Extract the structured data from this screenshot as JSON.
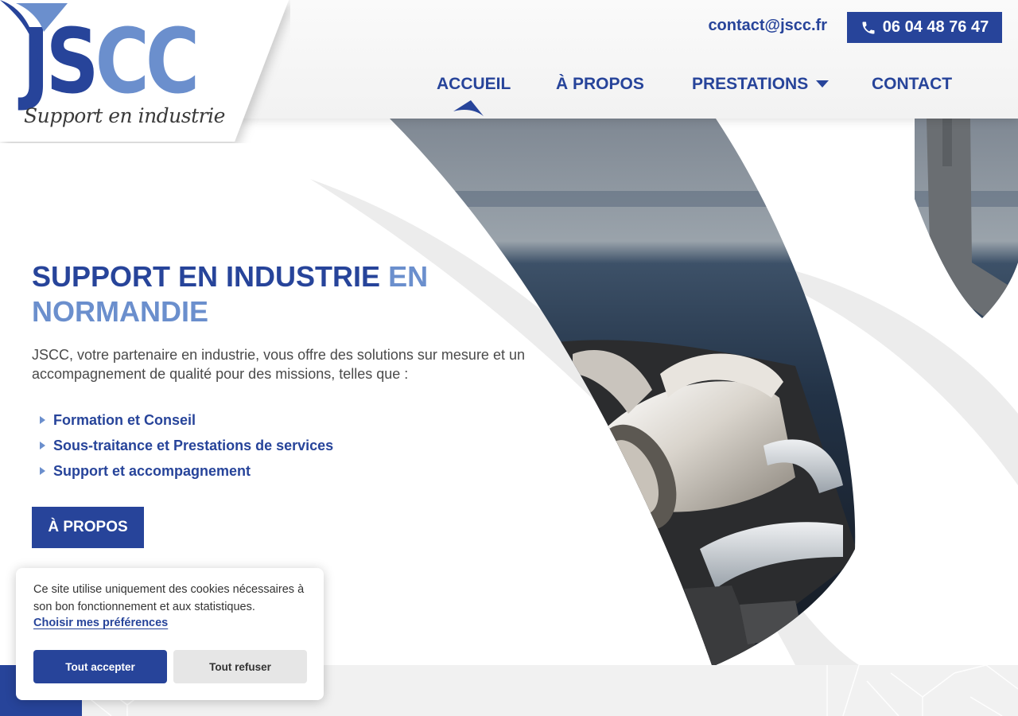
{
  "brand": {
    "logo_part1": "JS",
    "logo_part2": "CC",
    "tagline": "Support en industrie"
  },
  "header": {
    "email": "contact@jscc.fr",
    "phone": "06 04 48 76 47"
  },
  "nav": {
    "items": [
      {
        "label": "ACCUEIL",
        "active": true
      },
      {
        "label": "À PROPOS",
        "active": false
      },
      {
        "label": "PRESTATIONS",
        "active": false,
        "has_dropdown": true
      },
      {
        "label": "CONTACT",
        "active": false
      }
    ]
  },
  "hero": {
    "title_main": "SUPPORT EN INDUSTRIE ",
    "title_accent": "EN NORMANDIE",
    "description": "JSCC, votre partenaire en industrie, vous offre des solutions sur mesure et un accompagnement de qualité pour des missions, telles que :",
    "bullets": [
      "Formation et Conseil",
      "Sous-traitance et Prestations de services",
      "Support et accompagnement"
    ],
    "cta_label": "À PROPOS"
  },
  "cookie": {
    "text": "Ce site utilise uniquement des cookies nécessaires à son bon fonctionnement et aux statistiques.",
    "preferences_link": "Choisir mes préférences",
    "accept_label": "Tout accepter",
    "refuse_label": "Tout refuser"
  },
  "colors": {
    "primary": "#27449a",
    "accent": "#6b8fcd",
    "text": "#4a4a4a",
    "light_gray": "#f1f1f1"
  },
  "icons": {
    "phone": "phone-icon",
    "dropdown": "chevron-down-icon",
    "bullet": "triangle-right-icon"
  }
}
